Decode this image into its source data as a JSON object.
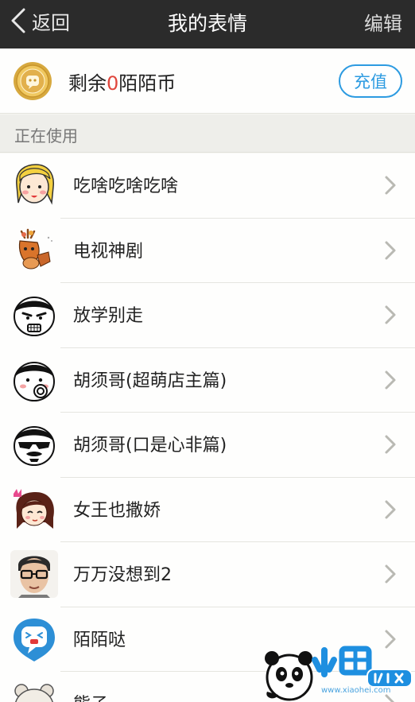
{
  "nav": {
    "back_label": "返回",
    "title": "我的表情",
    "edit_label": "编辑"
  },
  "coins": {
    "prefix": "剩余",
    "count": "0",
    "suffix": "陌陌币",
    "recharge_label": "充值"
  },
  "section": {
    "title": "正在使用"
  },
  "items": [
    {
      "label": "吃啥吃啥吃啥",
      "icon": "blonde-girl-face-icon"
    },
    {
      "label": "电视神剧",
      "icon": "cartoon-reindeer-icon"
    },
    {
      "label": "放学别走",
      "icon": "angry-man-face-icon"
    },
    {
      "label": "胡须哥(超萌店主篇)",
      "icon": "mustache-guy-face-icon"
    },
    {
      "label": "胡须哥(口是心非篇)",
      "icon": "mustache-guy-sunglasses-icon"
    },
    {
      "label": "女王也撒娇",
      "icon": "queen-girl-face-icon"
    },
    {
      "label": "万万没想到2",
      "icon": "glasses-man-face-icon"
    },
    {
      "label": "陌陌哒",
      "icon": "momo-mascot-icon"
    },
    {
      "label": "熊子",
      "icon": "bear-face-icon"
    }
  ],
  "watermark": {
    "text": "www.xiaohei.com"
  },
  "colors": {
    "navbar": "#2b2b2b",
    "accent_blue": "#2d9be1",
    "coin_count_red": "#e0463c"
  }
}
